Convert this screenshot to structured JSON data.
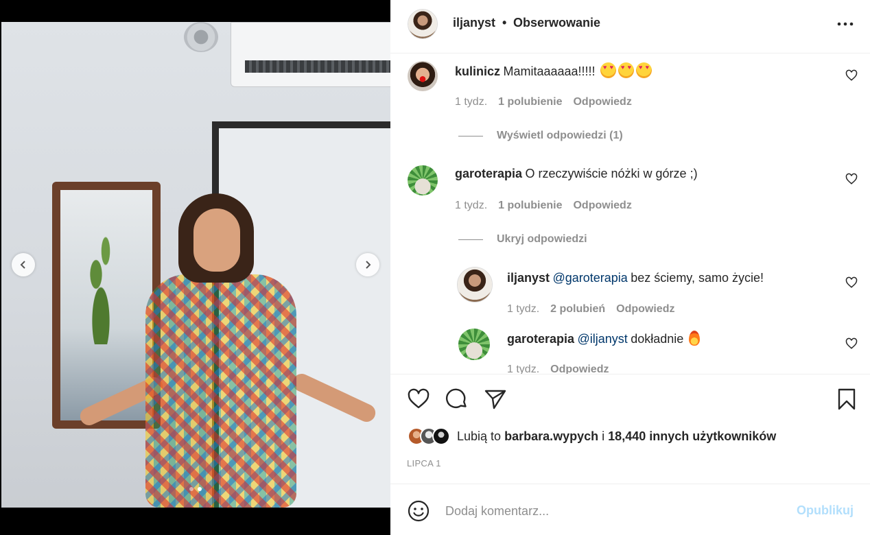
{
  "header": {
    "username": "iljanyst",
    "separator": "•",
    "follow_status": "Obserwowanie",
    "more_icon": "more-horizontal-icon"
  },
  "carousel": {
    "prev_icon": "chevron-left-icon",
    "next_icon": "chevron-right-icon",
    "slide_count": 2,
    "active_slide": 2
  },
  "comments": [
    {
      "username": "kulinicz",
      "text": "Mamitaaaaaa!!!!!",
      "emoji": [
        "heart-eyes-emoji",
        "heart-eyes-emoji",
        "heart-eyes-emoji"
      ],
      "time": "1 tydz.",
      "likes": "1 polubienie",
      "reply": "Odpowiedz",
      "toggle": "Wyświetl odpowiedzi (1)"
    },
    {
      "username": "garoterapia",
      "text": "O rzeczywiście nóżki w górze ;)",
      "time": "1 tydz.",
      "likes": "1 polubienie",
      "reply": "Odpowiedz",
      "toggle": "Ukryj odpowiedzi",
      "replies": [
        {
          "username": "iljanyst",
          "mention": "@garoterapia",
          "text": "bez ściemy, samo życie!",
          "time": "1 tydz.",
          "likes": "2 polubień",
          "reply": "Odpowiedz"
        },
        {
          "username": "garoterapia",
          "mention": "@iljanyst",
          "text": "dokładnie",
          "emoji": "fire-emoji",
          "time": "1 tydz.",
          "reply": "Odpowiedz"
        }
      ]
    }
  ],
  "actions": {
    "like_icon": "heart-icon",
    "comment_icon": "comment-icon",
    "share_icon": "send-icon",
    "save_icon": "bookmark-icon"
  },
  "likes": {
    "prefix": "Lubią to",
    "user": "barbara.wypych",
    "conj": "i",
    "others": "18,440 innych użytkowników"
  },
  "date": "LIPCA 1",
  "add_comment": {
    "placeholder": "Dodaj komentarz...",
    "publish_label": "Opublikuj",
    "emoji_icon": "smiley-icon"
  },
  "colors": {
    "text": "#262626",
    "muted": "#8e8e8e",
    "mention": "#00376b",
    "publish_disabled": "#b2dffc"
  }
}
